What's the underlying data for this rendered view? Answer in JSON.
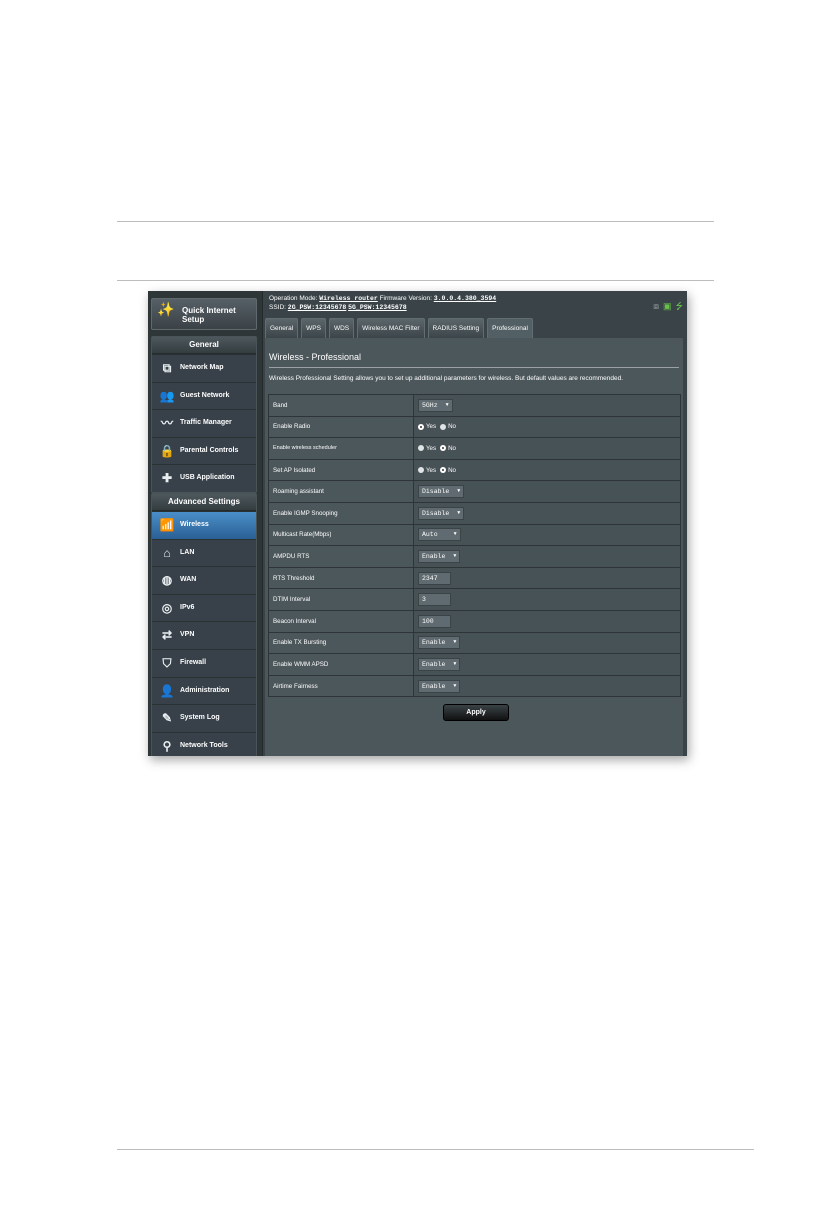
{
  "header": {
    "op_mode_label": "Operation Mode:",
    "op_mode_value": "Wireless router",
    "firmware_label": "Firmware Version:",
    "firmware_value": "3.0.0.4.380_3594",
    "ssid_label": "SSID:",
    "ssid_2g": "2G_PSW:12345678",
    "ssid_5g": "5G_PSW:12345678",
    "status_icons": [
      "network-icon",
      "router-status-icon",
      "usb-icon"
    ]
  },
  "sidebar": {
    "qis_label_1": "Quick Internet",
    "qis_label_2": "Setup",
    "general_title": "General",
    "general_items": [
      {
        "label": "Network Map",
        "icon": "network-map-icon"
      },
      {
        "label": "Guest Network",
        "icon": "guest-network-icon"
      },
      {
        "label": "Traffic Manager",
        "icon": "traffic-manager-icon"
      },
      {
        "label": "Parental Controls",
        "icon": "lock-icon"
      },
      {
        "label": "USB Application",
        "icon": "puzzle-icon"
      }
    ],
    "advanced_title": "Advanced Settings",
    "advanced_items": [
      {
        "label": "Wireless",
        "icon": "wifi-icon",
        "active": true
      },
      {
        "label": "LAN",
        "icon": "home-icon"
      },
      {
        "label": "WAN",
        "icon": "globe-icon"
      },
      {
        "label": "IPv6",
        "icon": "ipv6-icon"
      },
      {
        "label": "VPN",
        "icon": "vpn-icon"
      },
      {
        "label": "Firewall",
        "icon": "shield-icon"
      },
      {
        "label": "Administration",
        "icon": "admin-icon"
      },
      {
        "label": "System Log",
        "icon": "system-log-icon"
      },
      {
        "label": "Network Tools",
        "icon": "network-tools-icon"
      }
    ]
  },
  "tabs": [
    "General",
    "WPS",
    "WDS",
    "Wireless MAC Filter",
    "RADIUS Setting",
    "Professional"
  ],
  "active_tab": "Professional",
  "page": {
    "title": "Wireless - Professional",
    "description": "Wireless Professional Setting allows you to set up additional parameters for wireless. But default values are recommended."
  },
  "settings": [
    {
      "label": "Band",
      "type": "select",
      "value": "5GHz"
    },
    {
      "label": "Enable Radio",
      "type": "radio",
      "yes": "Yes",
      "no": "No",
      "selected": "Yes"
    },
    {
      "label": "Enable wireless scheduler",
      "type": "radio",
      "yes": "Yes",
      "no": "No",
      "selected": "No"
    },
    {
      "label": "Set AP Isolated",
      "type": "radio",
      "yes": "Yes",
      "no": "No",
      "selected": "No"
    },
    {
      "label": "Roaming assistant",
      "type": "select",
      "value": "Disable"
    },
    {
      "label": "Enable IGMP Snooping",
      "type": "select",
      "value": "Disable"
    },
    {
      "label": "Multicast Rate(Mbps)",
      "type": "select",
      "value": "Auto"
    },
    {
      "label": "AMPDU RTS",
      "type": "select",
      "value": "Enable"
    },
    {
      "label": "RTS Threshold",
      "type": "input",
      "value": "2347"
    },
    {
      "label": "DTIM Interval",
      "type": "input",
      "value": "3"
    },
    {
      "label": "Beacon Interval",
      "type": "input",
      "value": "100"
    },
    {
      "label": "Enable TX Bursting",
      "type": "select",
      "value": "Enable"
    },
    {
      "label": "Enable WMM APSD",
      "type": "select",
      "value": "Enable"
    },
    {
      "label": "Airtime Fairness",
      "type": "select",
      "value": "Enable"
    }
  ],
  "apply_label": "Apply",
  "colors": {
    "accent": "#3f86c3",
    "status_icon": "#68c24a",
    "background": "#3a4448"
  }
}
